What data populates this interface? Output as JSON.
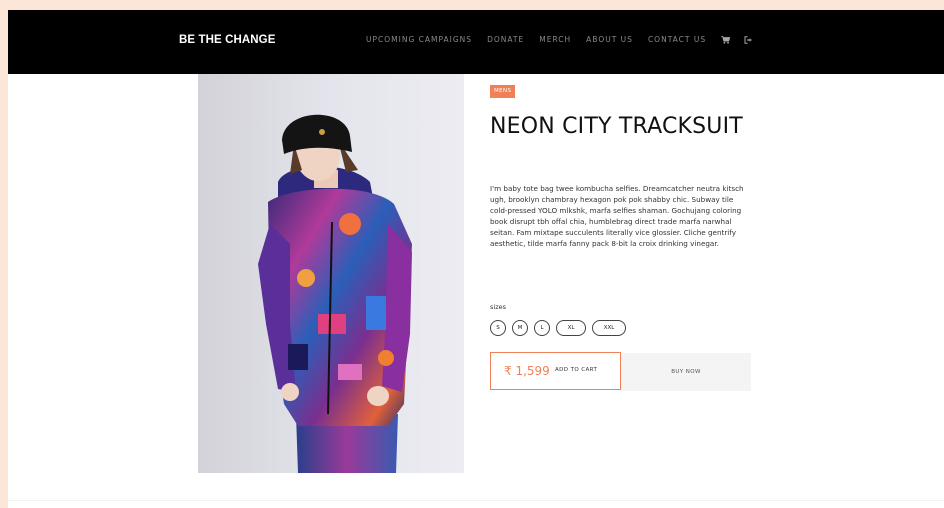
{
  "header": {
    "brand": "BE THE CHANGE",
    "nav": [
      {
        "label": "UPCOMING CAMPAIGNS"
      },
      {
        "label": "DONATE"
      },
      {
        "label": "MERCH"
      },
      {
        "label": "ABOUT US"
      },
      {
        "label": "CONTACT US"
      }
    ],
    "icons": [
      "cart-icon",
      "logout-icon"
    ]
  },
  "product": {
    "tag": "MENS",
    "title": "NEON CITY TRACKSUIT",
    "description": "I'm baby tote bag twee kombucha selfies. Dreamcatcher neutra kitsch ugh, brooklyn chambray hexagon pok pok shabby chic. Subway tile cold-pressed YOLO mlkshk, marfa selfies shaman. Gochujang coloring book disrupt tbh offal chia, humblebrag direct trade marfa narwhal seitan. Fam mixtape succulents literally vice glossier. Cliche gentrify aesthetic, tilde marfa fanny pack 8-bit la croix drinking vinegar.",
    "sizes_label": "sizes",
    "sizes": [
      "S",
      "M",
      "L",
      "XL",
      "XXL"
    ],
    "price": "₹ 1,599",
    "add_to_cart": "ADD TO CART",
    "buy_now": "BUY NOW"
  },
  "colors": {
    "accent": "#ef8058",
    "navbar": "#000000",
    "page_background": "#fce6d8"
  }
}
